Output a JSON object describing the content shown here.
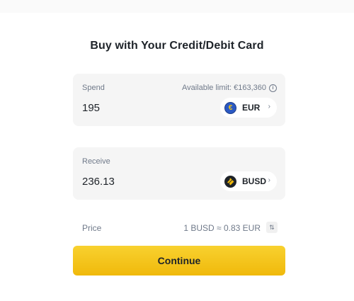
{
  "title": "Buy with Your Credit/Debit Card",
  "spend": {
    "label": "Spend",
    "available_limit": "Available limit: €163,360",
    "info_icon": "info-icon",
    "amount": "195",
    "currency": {
      "code": "EUR",
      "icon": "euro-coin-icon",
      "chevron": "›"
    }
  },
  "receive": {
    "label": "Receive",
    "amount": "236.13",
    "currency": {
      "code": "BUSD",
      "icon": "busd-coin-icon",
      "chevron": "›"
    }
  },
  "price": {
    "label": "Price",
    "value": "1 BUSD ≈ 0.83 EUR",
    "swap_icon": "swap-icon"
  },
  "continue_label": "Continue",
  "colors": {
    "accent": "#f0b90b",
    "text_primary": "#1e2329",
    "text_secondary": "#707a8a",
    "card_bg": "#f5f5f5"
  }
}
